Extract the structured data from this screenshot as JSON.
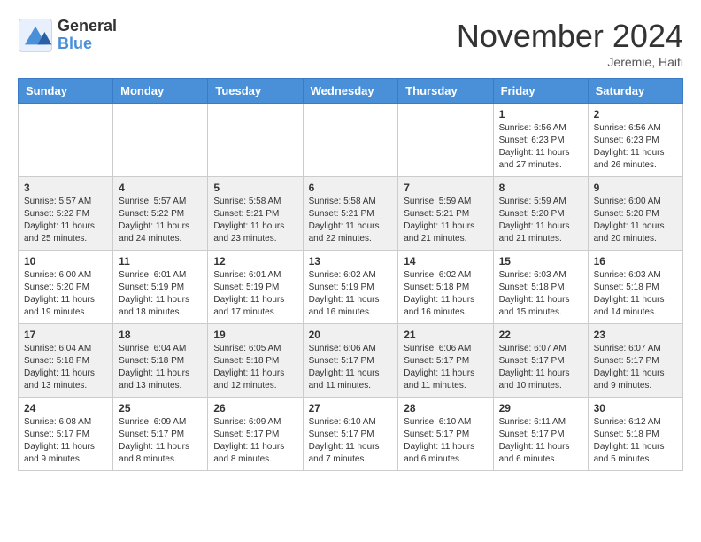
{
  "header": {
    "logo_general": "General",
    "logo_blue": "Blue",
    "month_title": "November 2024",
    "location": "Jeremie, Haiti"
  },
  "days_of_week": [
    "Sunday",
    "Monday",
    "Tuesday",
    "Wednesday",
    "Thursday",
    "Friday",
    "Saturday"
  ],
  "weeks": [
    [
      {
        "day": "",
        "info": ""
      },
      {
        "day": "",
        "info": ""
      },
      {
        "day": "",
        "info": ""
      },
      {
        "day": "",
        "info": ""
      },
      {
        "day": "",
        "info": ""
      },
      {
        "day": "1",
        "info": "Sunrise: 6:56 AM\nSunset: 6:23 PM\nDaylight: 11 hours and 27 minutes."
      },
      {
        "day": "2",
        "info": "Sunrise: 6:56 AM\nSunset: 6:23 PM\nDaylight: 11 hours and 26 minutes."
      }
    ],
    [
      {
        "day": "3",
        "info": "Sunrise: 5:57 AM\nSunset: 5:22 PM\nDaylight: 11 hours and 25 minutes."
      },
      {
        "day": "4",
        "info": "Sunrise: 5:57 AM\nSunset: 5:22 PM\nDaylight: 11 hours and 24 minutes."
      },
      {
        "day": "5",
        "info": "Sunrise: 5:58 AM\nSunset: 5:21 PM\nDaylight: 11 hours and 23 minutes."
      },
      {
        "day": "6",
        "info": "Sunrise: 5:58 AM\nSunset: 5:21 PM\nDaylight: 11 hours and 22 minutes."
      },
      {
        "day": "7",
        "info": "Sunrise: 5:59 AM\nSunset: 5:21 PM\nDaylight: 11 hours and 21 minutes."
      },
      {
        "day": "8",
        "info": "Sunrise: 5:59 AM\nSunset: 5:20 PM\nDaylight: 11 hours and 21 minutes."
      },
      {
        "day": "9",
        "info": "Sunrise: 6:00 AM\nSunset: 5:20 PM\nDaylight: 11 hours and 20 minutes."
      }
    ],
    [
      {
        "day": "10",
        "info": "Sunrise: 6:00 AM\nSunset: 5:20 PM\nDaylight: 11 hours and 19 minutes."
      },
      {
        "day": "11",
        "info": "Sunrise: 6:01 AM\nSunset: 5:19 PM\nDaylight: 11 hours and 18 minutes."
      },
      {
        "day": "12",
        "info": "Sunrise: 6:01 AM\nSunset: 5:19 PM\nDaylight: 11 hours and 17 minutes."
      },
      {
        "day": "13",
        "info": "Sunrise: 6:02 AM\nSunset: 5:19 PM\nDaylight: 11 hours and 16 minutes."
      },
      {
        "day": "14",
        "info": "Sunrise: 6:02 AM\nSunset: 5:18 PM\nDaylight: 11 hours and 16 minutes."
      },
      {
        "day": "15",
        "info": "Sunrise: 6:03 AM\nSunset: 5:18 PM\nDaylight: 11 hours and 15 minutes."
      },
      {
        "day": "16",
        "info": "Sunrise: 6:03 AM\nSunset: 5:18 PM\nDaylight: 11 hours and 14 minutes."
      }
    ],
    [
      {
        "day": "17",
        "info": "Sunrise: 6:04 AM\nSunset: 5:18 PM\nDaylight: 11 hours and 13 minutes."
      },
      {
        "day": "18",
        "info": "Sunrise: 6:04 AM\nSunset: 5:18 PM\nDaylight: 11 hours and 13 minutes."
      },
      {
        "day": "19",
        "info": "Sunrise: 6:05 AM\nSunset: 5:18 PM\nDaylight: 11 hours and 12 minutes."
      },
      {
        "day": "20",
        "info": "Sunrise: 6:06 AM\nSunset: 5:17 PM\nDaylight: 11 hours and 11 minutes."
      },
      {
        "day": "21",
        "info": "Sunrise: 6:06 AM\nSunset: 5:17 PM\nDaylight: 11 hours and 11 minutes."
      },
      {
        "day": "22",
        "info": "Sunrise: 6:07 AM\nSunset: 5:17 PM\nDaylight: 11 hours and 10 minutes."
      },
      {
        "day": "23",
        "info": "Sunrise: 6:07 AM\nSunset: 5:17 PM\nDaylight: 11 hours and 9 minutes."
      }
    ],
    [
      {
        "day": "24",
        "info": "Sunrise: 6:08 AM\nSunset: 5:17 PM\nDaylight: 11 hours and 9 minutes."
      },
      {
        "day": "25",
        "info": "Sunrise: 6:09 AM\nSunset: 5:17 PM\nDaylight: 11 hours and 8 minutes."
      },
      {
        "day": "26",
        "info": "Sunrise: 6:09 AM\nSunset: 5:17 PM\nDaylight: 11 hours and 8 minutes."
      },
      {
        "day": "27",
        "info": "Sunrise: 6:10 AM\nSunset: 5:17 PM\nDaylight: 11 hours and 7 minutes."
      },
      {
        "day": "28",
        "info": "Sunrise: 6:10 AM\nSunset: 5:17 PM\nDaylight: 11 hours and 6 minutes."
      },
      {
        "day": "29",
        "info": "Sunrise: 6:11 AM\nSunset: 5:17 PM\nDaylight: 11 hours and 6 minutes."
      },
      {
        "day": "30",
        "info": "Sunrise: 6:12 AM\nSunset: 5:18 PM\nDaylight: 11 hours and 5 minutes."
      }
    ]
  ]
}
